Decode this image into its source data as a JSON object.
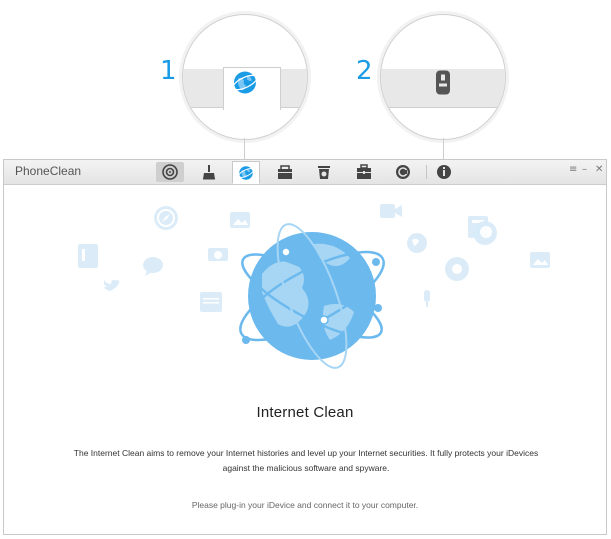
{
  "callouts": [
    {
      "number": "1",
      "icon": "globe-icon"
    },
    {
      "number": "2",
      "icon": "usb-icon"
    }
  ],
  "window": {
    "app_title": "PhoneClean",
    "toolbar": [
      {
        "icon": "quick-clean-icon",
        "state": "pressed"
      },
      {
        "icon": "broom-icon",
        "state": "normal"
      },
      {
        "icon": "globe-icon",
        "state": "active"
      },
      {
        "icon": "toolbox-icon",
        "state": "normal"
      },
      {
        "icon": "trash-icon",
        "state": "normal"
      },
      {
        "icon": "briefcase-icon",
        "state": "normal"
      },
      {
        "icon": "restore-icon",
        "state": "normal"
      },
      {
        "icon": "info-icon",
        "state": "normal"
      }
    ],
    "controls": {
      "menu": "≡",
      "minimize": "–",
      "close": "✕"
    }
  },
  "content": {
    "title": "Internet Clean",
    "description_line1": "The Internet Clean aims to remove your Internet histories and level up your Internet securities. It fully protects your iDevices",
    "description_line2": "against the malicious software and spyware.",
    "hint": "Please plug-in your iDevice and connect it to your computer."
  },
  "colors": {
    "accent": "#1a9be6",
    "globe": "#6cb9ee",
    "globe_light": "#a7d6f5",
    "bg_icons": "#d8ebf8"
  }
}
